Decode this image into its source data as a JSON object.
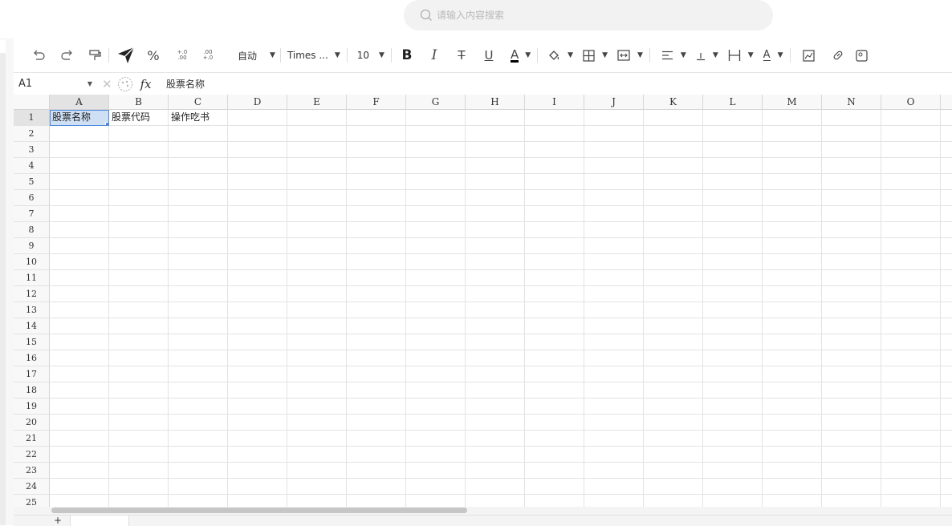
{
  "search": {
    "placeholder": "请输入内容搜索"
  },
  "toolbar": {
    "percent": "%",
    "decimal_inc": "+.0\n.00",
    "decimal_dec": ".00\n+.0",
    "number_format": "自动",
    "font_family": "Times ...",
    "font_size": "10",
    "bold": "B",
    "italic": "I",
    "strike": "T",
    "underline": "U",
    "font_color": "A",
    "text_rotate": "A",
    "font_color_value": "#000000"
  },
  "formula_bar": {
    "name_box": "A1",
    "fx": "fx",
    "content": "股票名称"
  },
  "grid": {
    "columns": [
      "A",
      "B",
      "C",
      "D",
      "E",
      "F",
      "G",
      "H",
      "I",
      "J",
      "K",
      "L",
      "M",
      "N",
      "O",
      ""
    ],
    "rows": [
      "1",
      "2",
      "3",
      "4",
      "5",
      "6",
      "7",
      "8",
      "9",
      "10",
      "11",
      "12",
      "13",
      "14",
      "15",
      "16",
      "17",
      "18",
      "19",
      "20",
      "21",
      "22",
      "23",
      "24",
      "25"
    ],
    "cells": [
      [
        "股票名称",
        "股票代码",
        "操作吃书"
      ]
    ]
  },
  "sheets": {
    "add_label": "+"
  }
}
